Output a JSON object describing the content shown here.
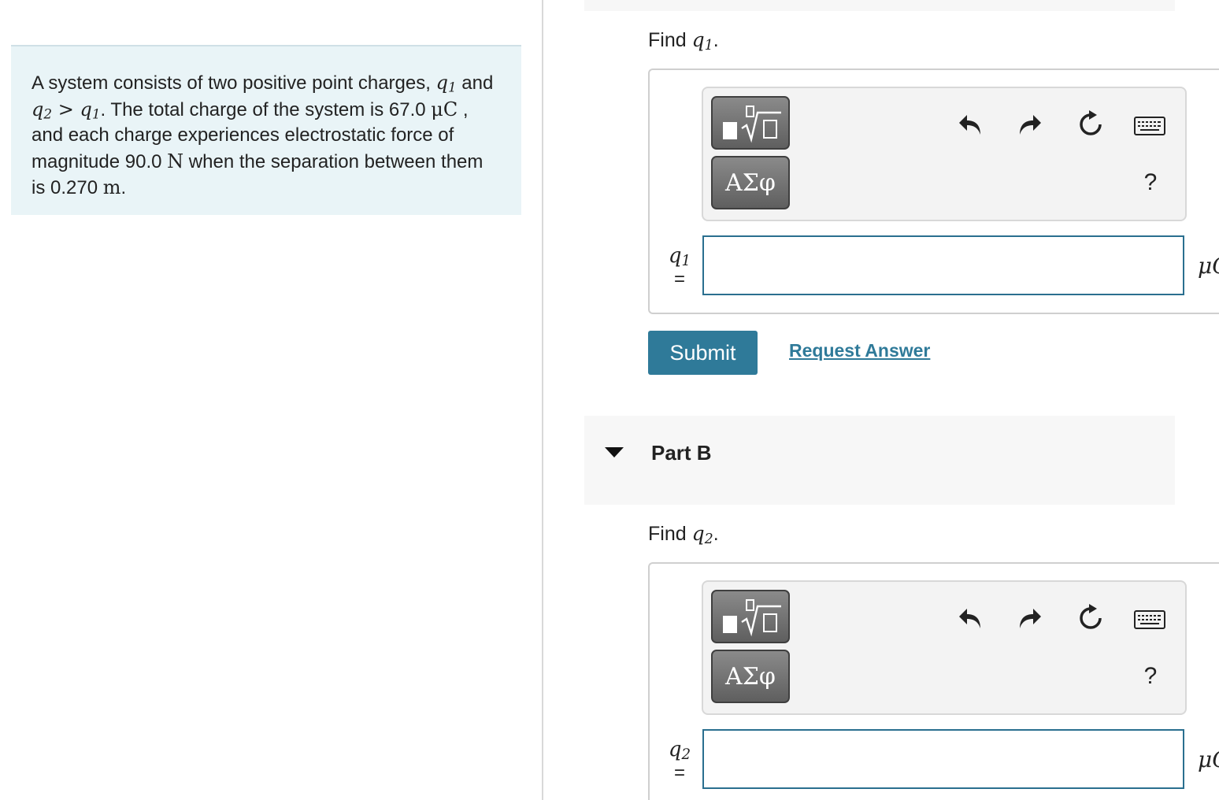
{
  "problem": {
    "s1": "A system consists of two positive point charges, ",
    "q1": "q",
    "q1sub": "1",
    "s2": " and ",
    "q2": "q",
    "q2sub": "2",
    "gt": " > ",
    "q1b": "q",
    "q1bsub": "1",
    "s3": ". The total charge of the system is 67.0 ",
    "uc": "μC",
    "s4": " , and each charge experiences electrostatic force of magnitude 90.0 ",
    "n": "N",
    "s5": " when the separation between them is 0.270 ",
    "m": "m",
    "s6": "."
  },
  "partA": {
    "find_prefix": "Find ",
    "var": "q",
    "var_sub": "1",
    "find_suffix": ".",
    "label_var": "q",
    "label_sub": "1",
    "label_eq": "=",
    "input_value": "",
    "unit": "μC",
    "greek_label": "ΑΣφ",
    "help": "?",
    "submit_label": "Submit",
    "request_label": "Request Answer"
  },
  "partB": {
    "title": "Part B",
    "find_prefix": "Find ",
    "var": "q",
    "var_sub": "2",
    "find_suffix": ".",
    "label_var": "q",
    "label_sub": "2",
    "label_eq": "=",
    "input_value": "",
    "unit": "μC",
    "greek_label": "ΑΣφ",
    "help": "?"
  },
  "icons": {
    "template": "fraction-root-template-icon",
    "undo": "undo-icon",
    "redo": "redo-icon",
    "reset": "reset-icon",
    "keyboard": "keyboard-icon"
  }
}
